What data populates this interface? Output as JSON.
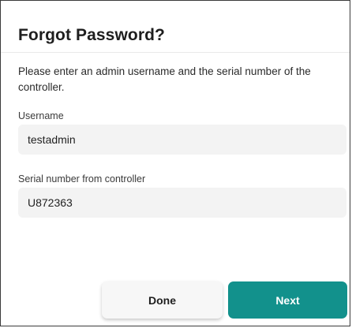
{
  "dialog": {
    "title": "Forgot Password?",
    "description": "Please enter an admin username and the serial number of the controller."
  },
  "fields": {
    "username": {
      "label": "Username",
      "value": "testadmin"
    },
    "serial": {
      "label": "Serial number from controller",
      "value": "U872363"
    }
  },
  "buttons": {
    "done_label": "Done",
    "next_label": "Next"
  },
  "colors": {
    "accent": "#12918c",
    "input_background": "#f3f3f3"
  }
}
